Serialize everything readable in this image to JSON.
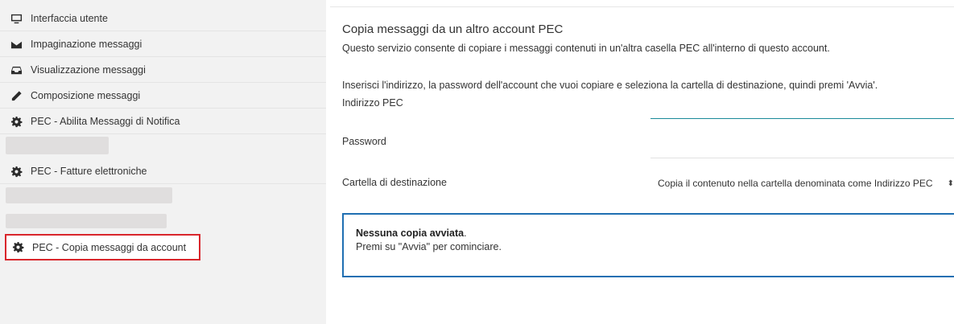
{
  "sidebar": {
    "items": [
      {
        "label": "Interfaccia utente",
        "icon": "monitor-icon"
      },
      {
        "label": "Impaginazione messaggi",
        "icon": "envelope-icon"
      },
      {
        "label": "Visualizzazione messaggi",
        "icon": "inbox-icon"
      },
      {
        "label": "Composizione messaggi",
        "icon": "pencil-icon"
      },
      {
        "label": "PEC - Abilita Messaggi di Notifica",
        "icon": "gear-icon"
      },
      {
        "label": "PEC - Fatture elettroniche",
        "icon": "gear-icon"
      },
      {
        "label": "PEC - Copia messaggi da account",
        "icon": "gear-icon"
      }
    ],
    "highlight_color": "#d9262c"
  },
  "main": {
    "title": "Copia messaggi da un altro account PEC",
    "description": "Questo servizio consente di copiare i messaggi contenuti in un'altra casella PEC all'interno di questo account.",
    "instructions": "Inserisci l'indirizzo, la password dell'account che vuoi copiare e seleziona la cartella di destinazione, quindi premi 'Avvia'.",
    "fields": {
      "address_label": "Indirizzo PEC",
      "address_value": "",
      "password_label": "Password",
      "password_value": "",
      "destination_label": "Cartella di destinazione",
      "destination_value": "Copia il contenuto nella cartella denominata come Indirizzo PEC"
    },
    "status": {
      "bold": "Nessuna copia avviata",
      "after_bold": ".",
      "hint": "Premi su \"Avvia\" per cominciare.",
      "border_color": "#1f6fb2"
    }
  }
}
